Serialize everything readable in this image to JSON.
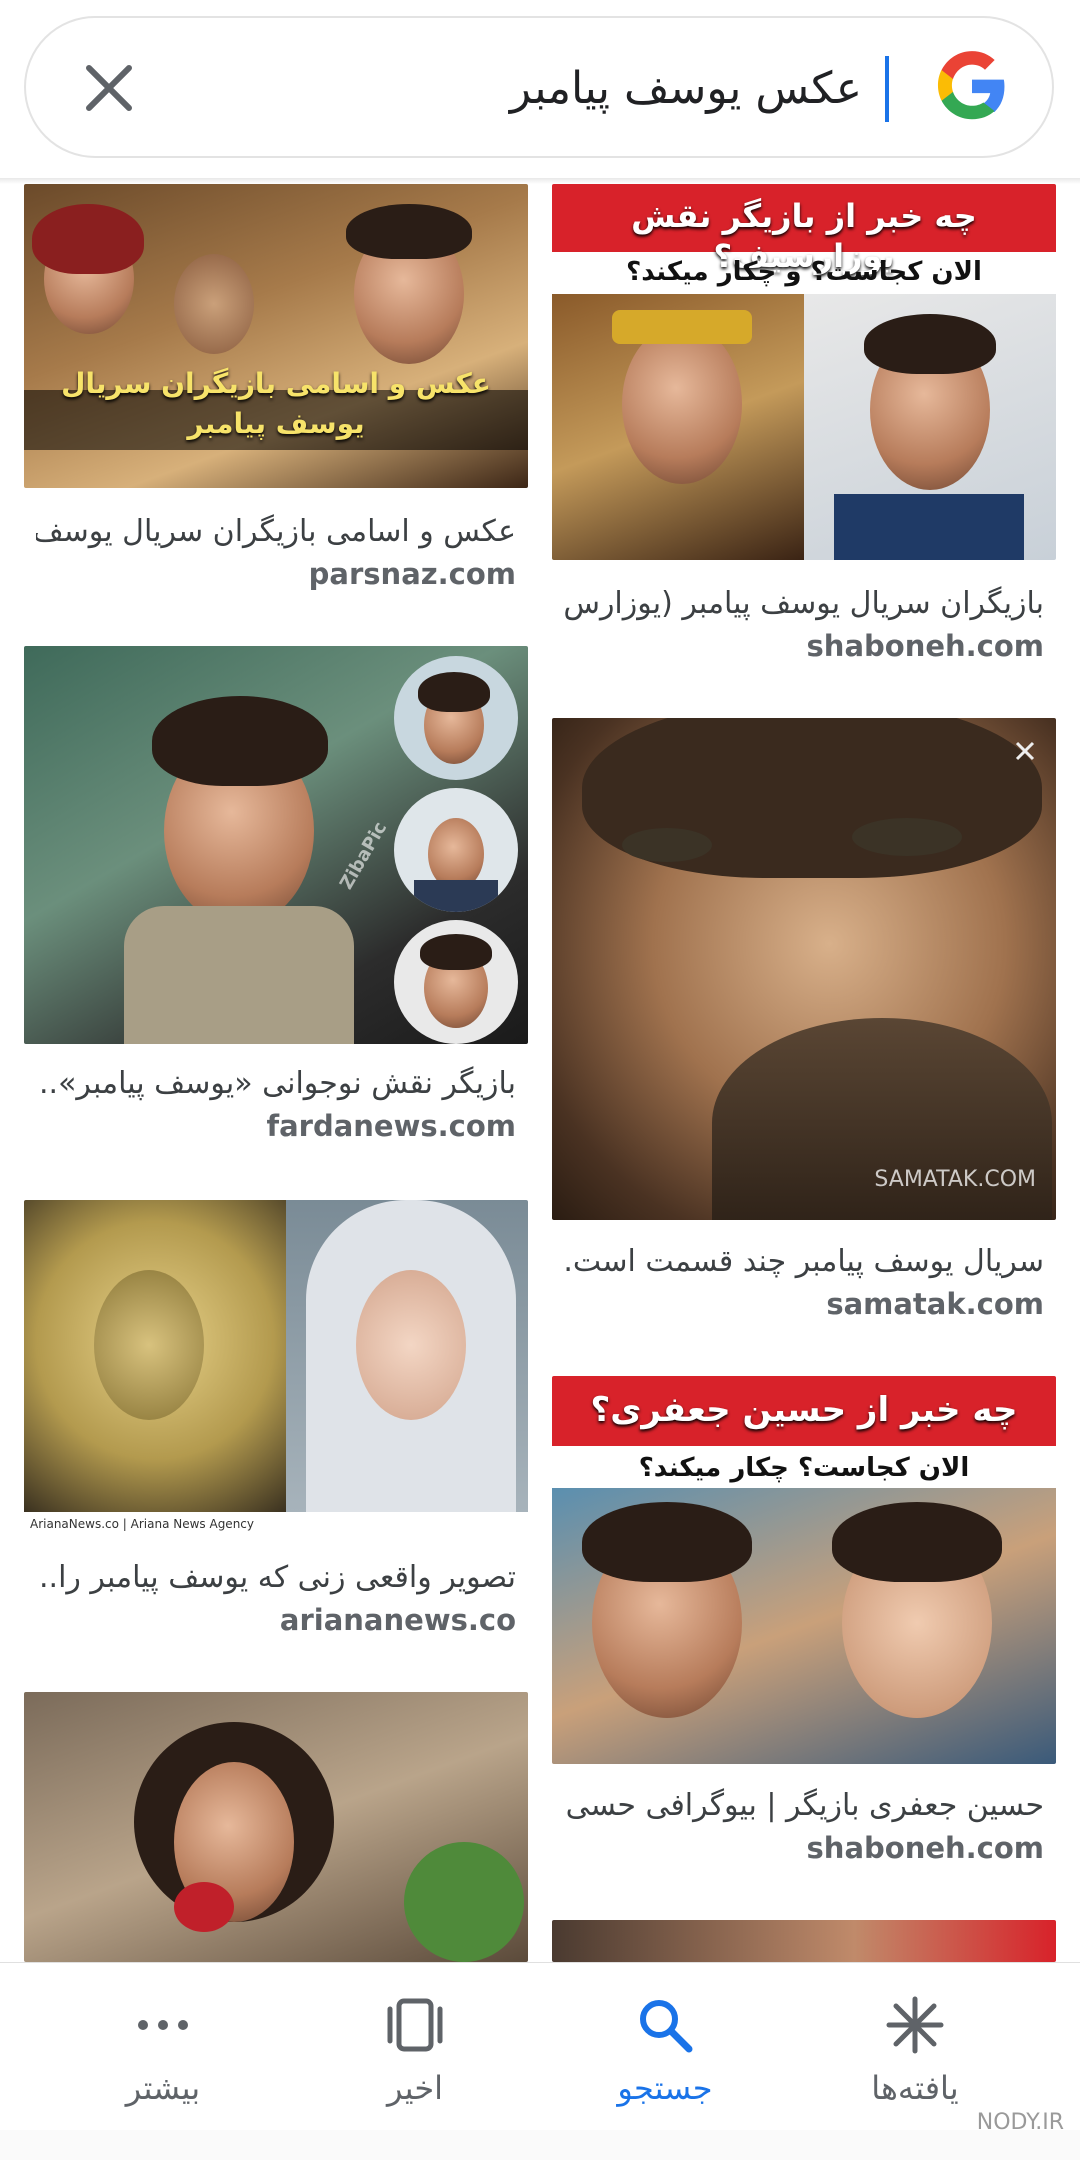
{
  "search": {
    "query": "عکس یوسف پیامبر",
    "close_icon": "close-icon",
    "logo": "google-logo"
  },
  "results": {
    "left": [
      {
        "caption": "عکس و اسامی بازیگران سریال یوسف..",
        "domain": "parsnaz.com",
        "overlay": "عکس و اسامی بازیگران سریال یوسف پیامبر"
      },
      {
        "caption": "بازیگر نقش نوجوانی «یوسف پیامبر»...",
        "domain": "fardanews.com",
        "overlay": "ZibaPic"
      },
      {
        "caption": "تصویر واقعی زنی که یوسف پیامبر را...",
        "domain": "ariananews.co",
        "overlay": "ArianaNews.co | Ariana News Agency"
      },
      {
        "caption": "",
        "domain": "",
        "overlay": ""
      }
    ],
    "right": [
      {
        "caption": "بازیگران سریال یوسف پیامبر (یوزارس .",
        "domain": "shaboneh.com",
        "overlay_top": "چه خبر از بازیگر نقش یوزارسیف؟",
        "overlay_sub": "الان کجاست؟ و چکار میکند؟"
      },
      {
        "caption": "سریال یوسف پیامبر چند قسمت است...",
        "domain": "samatak.com",
        "overlay": "SAMATAK.COM"
      },
      {
        "caption": "حسین جعفری بازیگر | بیوگرافی حسی ..",
        "domain": "shaboneh.com",
        "overlay_top": "چه خبر از حسین جعفری؟",
        "overlay_sub": "الان کجاست؟ چکار میکند؟"
      }
    ]
  },
  "nav": [
    {
      "label": "یافته‌ها",
      "icon": "asterisk-icon"
    },
    {
      "label": "جستجو",
      "icon": "search-icon",
      "active": true
    },
    {
      "label": "اخیر",
      "icon": "recent-tabs-icon"
    },
    {
      "label": "بیشتر",
      "icon": "more-dots-icon"
    }
  ],
  "watermark": "NODY.IR",
  "colors": {
    "accent": "#1a73e8",
    "text": "#3c4043",
    "muted": "#5f6368"
  }
}
